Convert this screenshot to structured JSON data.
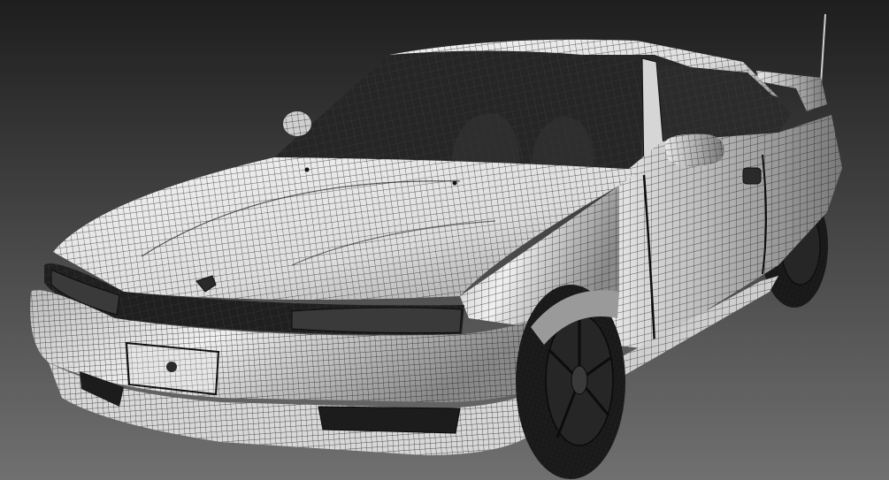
{
  "scene": {
    "subject": "car-wireframe-render",
    "colors": {
      "background_top": "#202020",
      "background_bottom": "#6e6e6e",
      "body_light": "#ececec",
      "body_shadow": "#7c7c7c",
      "mesh_line": "#151515",
      "glass": "#2a2a2a",
      "tire": "#1d1d1d",
      "rim": "#262626"
    }
  },
  "license_plate": {
    "text": ""
  }
}
